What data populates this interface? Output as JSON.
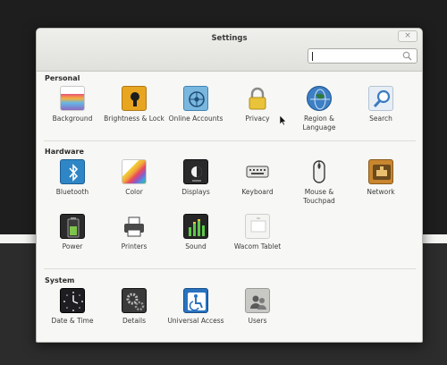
{
  "window": {
    "title": "Settings",
    "close_glyph": "×"
  },
  "search": {
    "value": "",
    "placeholder": ""
  },
  "sections": [
    {
      "label": "Personal",
      "items": [
        {
          "label": "Background",
          "icon": "background-icon"
        },
        {
          "label": "Brightness & Lock",
          "icon": "brightness-lock-icon"
        },
        {
          "label": "Online Accounts",
          "icon": "online-accounts-icon"
        },
        {
          "label": "Privacy",
          "icon": "lock-icon"
        },
        {
          "label": "Region & Language",
          "icon": "globe-icon"
        },
        {
          "label": "Search",
          "icon": "search-icon"
        }
      ]
    },
    {
      "label": "Hardware",
      "items": [
        {
          "label": "Bluetooth",
          "icon": "bluetooth-icon"
        },
        {
          "label": "Color",
          "icon": "color-icon"
        },
        {
          "label": "Displays",
          "icon": "display-icon"
        },
        {
          "label": "Keyboard",
          "icon": "keyboard-icon"
        },
        {
          "label": "Mouse & Touchpad",
          "icon": "mouse-icon"
        },
        {
          "label": "Network",
          "icon": "network-icon"
        },
        {
          "label": "Power",
          "icon": "battery-icon"
        },
        {
          "label": "Printers",
          "icon": "printer-icon"
        },
        {
          "label": "Sound",
          "icon": "sound-icon"
        },
        {
          "label": "Wacom Tablet",
          "icon": "tablet-icon"
        }
      ]
    },
    {
      "label": "System",
      "items": [
        {
          "label": "Date & Time",
          "icon": "clock-icon"
        },
        {
          "label": "Details",
          "icon": "gears-icon"
        },
        {
          "label": "Universal Access",
          "icon": "accessibility-icon"
        },
        {
          "label": "Users",
          "icon": "users-icon"
        }
      ]
    }
  ]
}
